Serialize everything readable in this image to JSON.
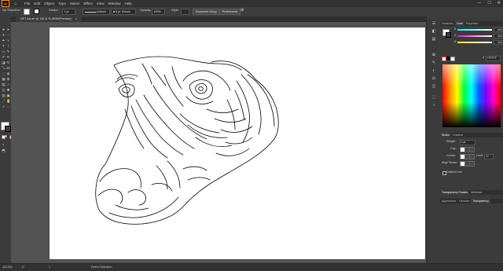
{
  "menubar": {
    "logo": "Ai",
    "items": [
      "File",
      "Edit",
      "Object",
      "Type",
      "Select",
      "Effect",
      "View",
      "Window",
      "Help"
    ],
    "window_controls": [
      "—",
      "☐",
      "✕"
    ]
  },
  "control_bar": {
    "selection": "No Selection",
    "stroke_label": "Stroke:",
    "stroke_value": "1 pt",
    "profile_label": "Uniform",
    "brush_value": "5 pt. Round",
    "opacity_label": "Opacity:",
    "opacity_value": "100%",
    "style_label": "Style:",
    "document_setup": "Document Setup",
    "preferences": "Preferences"
  },
  "document_tab": {
    "title": "NFT Art.ai* @ 161.8 % (RGB/Preview)",
    "close": "×"
  },
  "panels": {
    "top_tabs": [
      "Swatches",
      "Color",
      "Properties"
    ],
    "active_top_tab": "Color",
    "color_channels": [
      {
        "letter": "R",
        "value": "255"
      },
      {
        "letter": "G",
        "value": "255"
      },
      {
        "letter": "B",
        "value": "255"
      }
    ],
    "hex_prefix": "#",
    "hex_value": "FFFFFF",
    "stroke_tabs": [
      "Stroke",
      "Gradient"
    ],
    "weight_label": "Weight:",
    "weight_value": "1 pt",
    "cap_label": "Cap:",
    "corner_label": "Corner:",
    "limit_label": "Limit:",
    "limit_value": "10",
    "align_label": "Align Stroke:",
    "dashed_label": "Dashed Line",
    "middle_tabs": [
      "Transparency Presets",
      "Attributes"
    ],
    "bottom_tabs": [
      "Appearance",
      "Libraries",
      "Transparency"
    ],
    "active_bottom_tab": "Transparency"
  },
  "status_bar": {
    "zoom": "161.8%",
    "angle": "0°",
    "artboard": "1",
    "tool": "Direct Selection"
  },
  "colors": {
    "accent": "#ff9a00",
    "ui_dark": "#323232",
    "ui_mid": "#3b3b3b",
    "pasteboard": "#535353",
    "artboard": "#ffffff"
  },
  "icons": [
    "home-icon",
    "selection-tool-icon",
    "direct-selection-tool-icon",
    "pen-tool-icon",
    "type-tool-icon",
    "line-tool-icon",
    "rectangle-tool-icon",
    "brush-tool-icon",
    "pencil-tool-icon",
    "eraser-tool-icon",
    "rotate-tool-icon",
    "scale-tool-icon",
    "width-tool-icon",
    "shape-builder-tool-icon",
    "gradient-tool-icon",
    "eyedropper-tool-icon",
    "blend-tool-icon",
    "symbol-sprayer-tool-icon",
    "graph-tool-icon",
    "artboard-tool-icon",
    "slice-tool-icon",
    "hand-tool-icon",
    "zoom-tool-icon"
  ]
}
